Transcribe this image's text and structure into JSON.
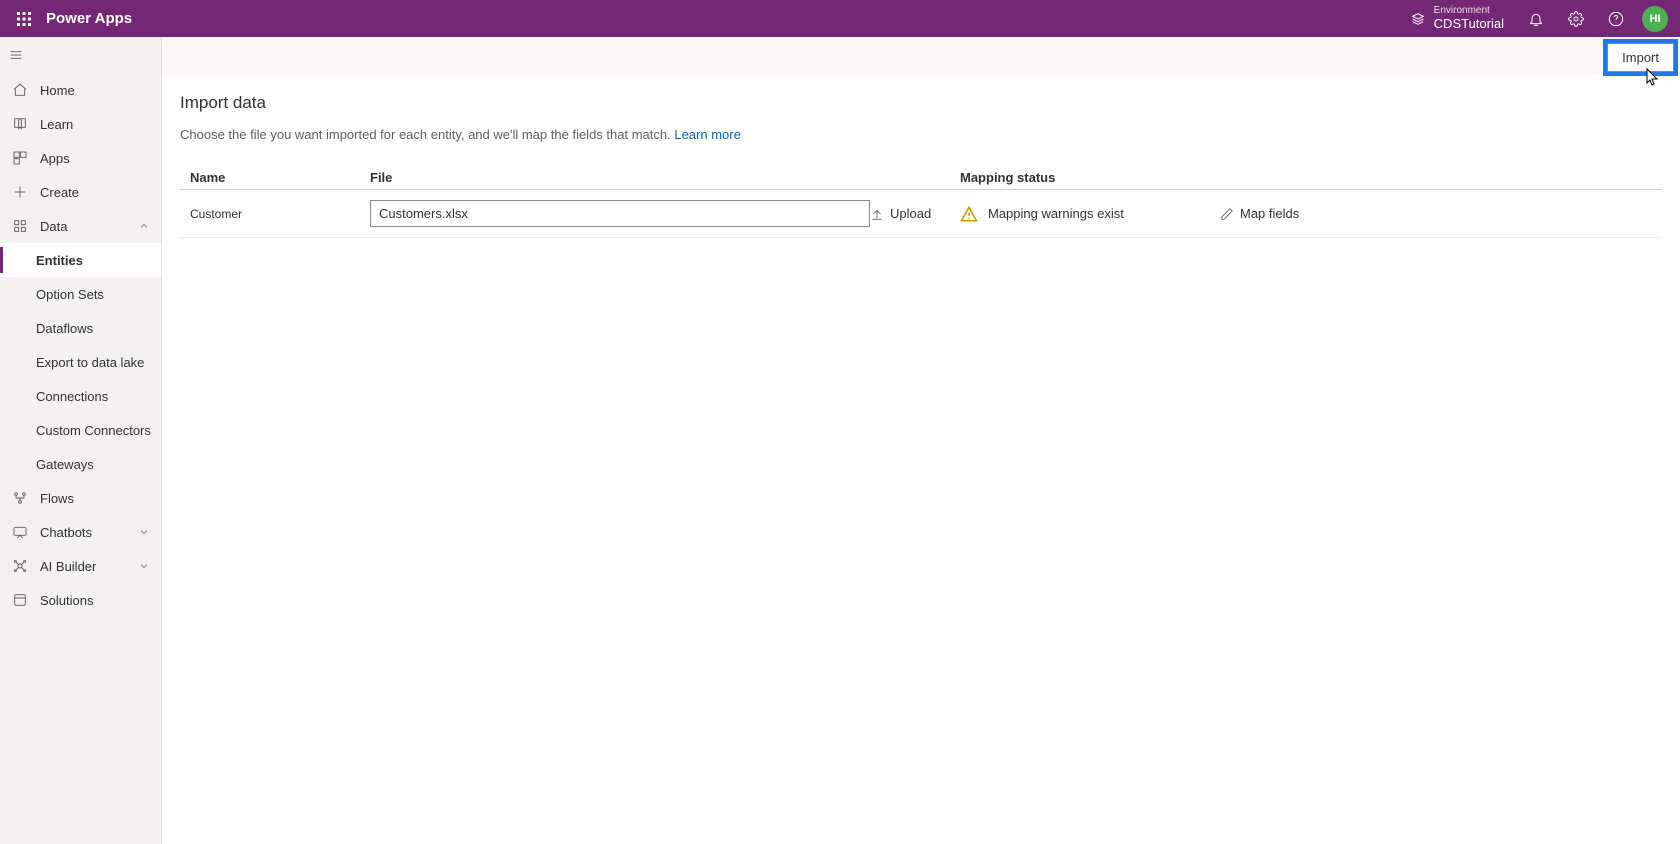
{
  "header": {
    "app_title": "Power Apps",
    "environment_label": "Environment",
    "environment_name": "CDSTutorial",
    "avatar_initials": "HI"
  },
  "nav": {
    "home": "Home",
    "learn": "Learn",
    "apps": "Apps",
    "create": "Create",
    "data": "Data",
    "data_children": {
      "entities": "Entities",
      "option_sets": "Option Sets",
      "dataflows": "Dataflows",
      "export_lake": "Export to data lake",
      "connections": "Connections",
      "custom_connectors": "Custom Connectors",
      "gateways": "Gateways"
    },
    "flows": "Flows",
    "chatbots": "Chatbots",
    "ai_builder": "AI Builder",
    "solutions": "Solutions"
  },
  "toolbar": {
    "import_label": "Import"
  },
  "page": {
    "title": "Import data",
    "description_prefix": "Choose the file you want imported for each entity, and we'll map the fields that match. ",
    "learn_more": "Learn more"
  },
  "grid": {
    "headers": {
      "name": "Name",
      "file": "File",
      "mapping_status": "Mapping status"
    },
    "actions": {
      "upload": "Upload",
      "map_fields": "Map fields"
    },
    "rows": [
      {
        "name": "Customer",
        "file": "Customers.xlsx",
        "status": "Mapping warnings exist"
      }
    ]
  }
}
